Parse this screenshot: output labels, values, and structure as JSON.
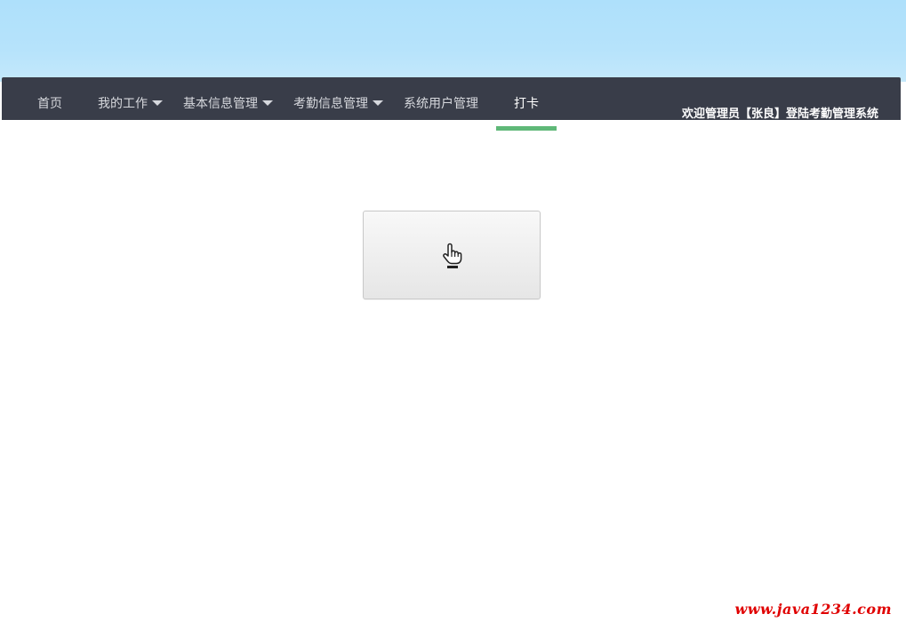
{
  "navbar": {
    "items": [
      {
        "label": "首页",
        "has_dropdown": false
      },
      {
        "label": "我的工作",
        "has_dropdown": true
      },
      {
        "label": "基本信息管理",
        "has_dropdown": true
      },
      {
        "label": "考勤信息管理",
        "has_dropdown": true
      },
      {
        "label": "系统用户管理",
        "has_dropdown": false
      },
      {
        "label": "打卡",
        "has_dropdown": false,
        "active": true
      }
    ],
    "welcome_text": "欢迎管理员【张良】登陆考勤管理系统"
  },
  "main": {
    "punch_button_icon": "pointing-hand-icon"
  },
  "watermark": "www.java1234.com",
  "colors": {
    "banner": "#aee0fb",
    "navbar_bg": "#393d49",
    "active_indicator": "#5fb878",
    "watermark": "#e00000"
  }
}
